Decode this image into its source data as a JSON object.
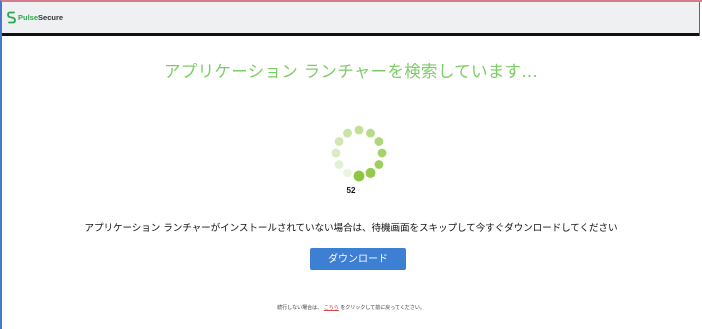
{
  "header": {
    "logo_pulse": "Pulse",
    "logo_secure": "Secure"
  },
  "main": {
    "title": "アプリケーション ランチャーを検索しています...",
    "progress_counter": "52",
    "instruction": "アプリケーション ランチャーがインストールされていない場合は、待機画面をスキップして今すぐダウンロードしてください",
    "download_button_label": "ダウンロード"
  },
  "footer": {
    "prefix": "続行しない場合は、",
    "link_text": "こちら",
    "suffix": "をクリックして前に戻ってください。"
  },
  "colors": {
    "title_green": "#7ccc66",
    "spinner_green": "#8dc63f",
    "button_blue": "#3d7fd3",
    "link_red": "#d04848",
    "header_bg": "#eef0f1"
  },
  "icons": {
    "logo": "pulse-secure-s-icon",
    "spinner": "loading-spinner-icon"
  }
}
